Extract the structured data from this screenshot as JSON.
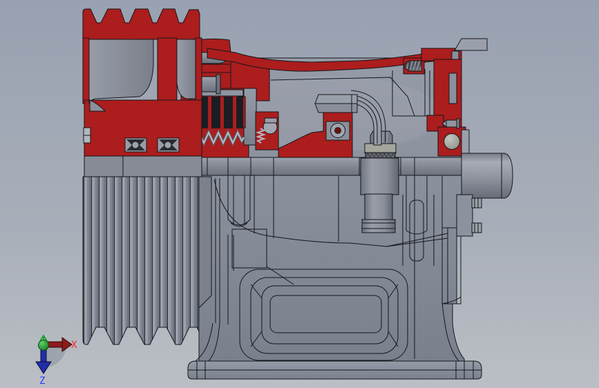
{
  "triad": {
    "x_label": "X",
    "z_label": "Z"
  },
  "palette": {
    "bg_top": "#98A1B1",
    "bg_mid": "#A9AFB9",
    "bg_bottom": "#BBBFC5",
    "section_red": "#AC1D1D",
    "section_red_dark": "#8C1616",
    "edge": "#14161A",
    "part_gray": "#8A8F9B",
    "part_gray_light": "#A6ABB5",
    "part_gray_dark": "#6E7380",
    "interior_top": "#959BA7",
    "interior_bottom": "#7A808C",
    "plate_dark": "#1B1D23",
    "spring_light": "#B3B7C1",
    "spring_dark": "#565A64",
    "knurl_base": "#54565D",
    "thread_base": "#62666E",
    "ball_light": "#C4C7BF",
    "ball_dark": "#8A8E86",
    "gear_disc": "#A4A59C",
    "triad_x": "#8E1B1B",
    "triad_z": "#202FA6",
    "triad_green": "#17A129",
    "label_x": "#FF2222",
    "label_z": "#2A3AFF",
    "shadow": "#868B95"
  },
  "scene": {
    "parts": [
      {
        "name": "v-belt-pulley-section",
        "color_role": "section_red"
      },
      {
        "name": "pulley-groove-face",
        "color_role": "part_gray"
      },
      {
        "name": "clutch-assembly",
        "color_role": "section_red"
      },
      {
        "name": "friction-plate-pack",
        "color_role": "plate_dark"
      },
      {
        "name": "clutch-spring",
        "color_role": "spring_light"
      },
      {
        "name": "ball-bearings",
        "color_role": "part_gray"
      },
      {
        "name": "housing-top-wall",
        "color_role": "section_red"
      },
      {
        "name": "gearbox-housing",
        "color_role": "part_gray"
      },
      {
        "name": "shift-fork",
        "color_role": "part_gray"
      },
      {
        "name": "sliding-gear-hub",
        "color_role": "part_gray"
      },
      {
        "name": "main-shaft",
        "color_role": "part_gray"
      },
      {
        "name": "end-cover",
        "color_role": "section_red"
      },
      {
        "name": "output-shaft",
        "color_role": "part_gray"
      },
      {
        "name": "mounting-base",
        "color_role": "part_gray"
      },
      {
        "name": "orientation-triad",
        "color_role": "triad_green"
      }
    ]
  }
}
